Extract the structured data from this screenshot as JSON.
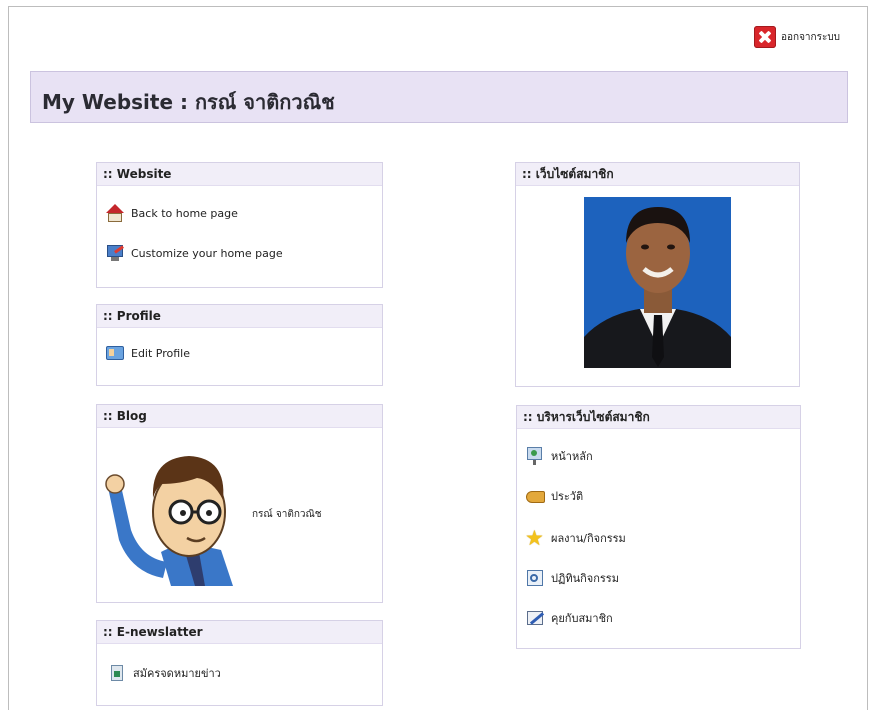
{
  "logout": {
    "label": "ออกจากระบบ",
    "icon": "close-icon"
  },
  "header": {
    "title": "My Website : กรณ์ จาติกวณิช"
  },
  "panels": {
    "website": {
      "title": ":: Website",
      "items": [
        {
          "label": "Back to home page",
          "icon": "home-icon"
        },
        {
          "label": "Customize your home page",
          "icon": "customize-icon"
        }
      ]
    },
    "profile": {
      "title": ":: Profile",
      "items": [
        {
          "label": "Edit Profile",
          "icon": "profile-card-icon"
        }
      ]
    },
    "blog": {
      "title": ":: Blog",
      "caption": "กรณ์ จาติกวณิช"
    },
    "enews": {
      "title": ":: E-newslatter",
      "items": [
        {
          "label": "สมัครจดหมายข่าว",
          "icon": "newsletter-icon"
        }
      ]
    },
    "member_site": {
      "title": ":: เว็บไซต์สมาชิก"
    },
    "member_admin": {
      "title": ":: บริหารเว็บไซต์สมาชิก",
      "items": [
        {
          "label": "หน้าหลัก",
          "icon": "monitor-home-icon"
        },
        {
          "label": "ประวัติ",
          "icon": "book-icon"
        },
        {
          "label": "ผลงาน/กิจกรรม",
          "icon": "star-icon"
        },
        {
          "label": "ปฏิทินกิจกรรม",
          "icon": "calendar-icon"
        },
        {
          "label": "คุยกับสมาชิก",
          "icon": "chat-pen-icon"
        }
      ]
    }
  },
  "colors": {
    "header_bg": "#e8e2f4",
    "panel_header_bg": "#f1eef8",
    "logout_red": "#d9262b"
  }
}
